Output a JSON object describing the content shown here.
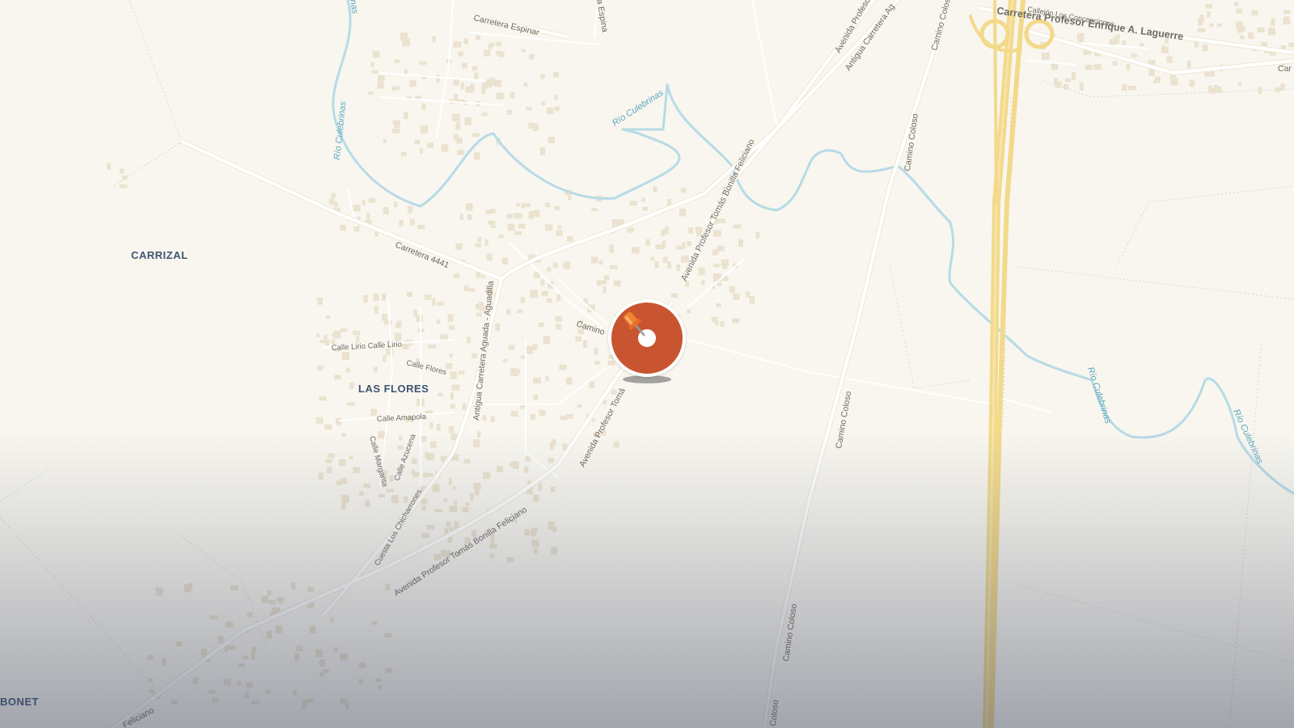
{
  "map": {
    "places": {
      "carrizal": "CARRIZAL",
      "las_flores": "LAS FLORES",
      "bonet": "BONET"
    },
    "roads": {
      "carretera_espinar": "Carretera Espinar",
      "espina_fragment": "a Espina",
      "carretera_4441": "Carretera 4441",
      "avenida_tomas_bonilla_upper": "Avenida Profesor Tomás Bonilla Feliciano",
      "avenida_tomas_bonilla_lower": "Avenida Profesor Tomás Bonilla Feliciano",
      "avenida_tomas_fragment": "Avenida Profesor Tomá",
      "avenida_profesor_top": "Avenida Profeso",
      "antigua_carretera_top": "Antigua Carretera Ag",
      "antigua_carretera_aguada": "Antigua Carretera Aguada - Aguadilla",
      "camino_coloso_top": "Camino Coloso",
      "camino_coloso_corner": "Camino Colos",
      "camino_coloso_mid": "Camino Coloso",
      "camino_coloso_low": "Camino Coloso",
      "coloso_bottom": "Coloso",
      "carretera_laguerre": "Carretera Profesor Enrique A. Laguerre",
      "callejon_concepciones": "Callejón Los Concepciones",
      "car_fragment": "Car",
      "camino": "Camino",
      "calle_lirio": "Calle Lirio Calle Lirio",
      "calle_flores": "Calle Flores",
      "calle_amapola": "Calle Amapola",
      "calle_margarita": "Calle Margarita",
      "calle_azucena": "Calle Azucena",
      "cuesta_chicharrones": "Cuesta Los Chicharrones",
      "feliciano_fragment": "Feliciano"
    },
    "water": {
      "rio_top_left": "Río Culebrinas",
      "rio_left": "Río Culebrinas",
      "rio_mid": "Río Culebrinas",
      "rio_right_a": "Río Culebrinas",
      "rio_right_b": "Río Culebrinas",
      "nas_fragment": "nas"
    }
  },
  "marker": {
    "icon": "pushpin-icon",
    "color": "#c8552f"
  },
  "colors": {
    "land": "#f8f6ef",
    "highway": "#f3d98a",
    "road": "#ffffff",
    "water": "#b6dbe6",
    "building": "#ebe2cf",
    "place_label": "#3f5574"
  }
}
